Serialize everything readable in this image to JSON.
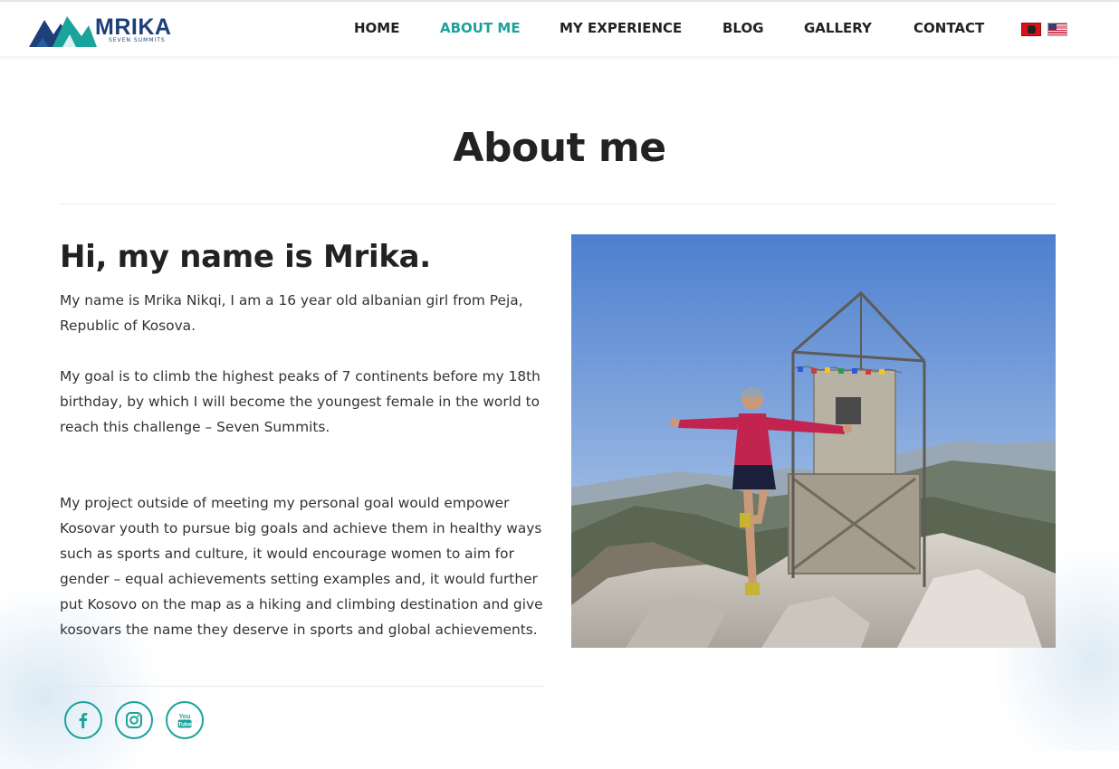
{
  "header": {
    "logo_text": "MRIKA",
    "logo_subtitle": "SEVEN SUMMITS",
    "nav": [
      {
        "label": "HOME"
      },
      {
        "label": "ABOUT ME"
      },
      {
        "label": "MY EXPERIENCE"
      },
      {
        "label": "BLOG"
      },
      {
        "label": "GALLERY"
      },
      {
        "label": "CONTACT"
      }
    ],
    "active_nav": "ABOUT ME",
    "languages": [
      "albanian-flag-icon",
      "us-flag-icon"
    ]
  },
  "page": {
    "title": "About me"
  },
  "about": {
    "greeting": "Hi, my name is Mrika.",
    "paragraphs": [
      "My name is Mrika Nikqi, I am a 16 year old albanian girl from Peja, Republic of Kosova.",
      "My goal is to climb the highest peaks of 7 continents before my 18th birthday, by which I will become the youngest female in the world to reach this challenge – Seven Summits.",
      "My project outside of meeting my personal goal would empower Kosovar youth to pursue big goals and achieve them in healthy ways such as sports and culture, it would encourage women to aim for gender – equal achievements setting examples and, it would further put Kosovo on the map as a hiking and climbing destination and give kosovars the name they deserve in sports and global achievements."
    ]
  },
  "social": [
    "facebook-icon",
    "instagram-icon",
    "youtube-icon"
  ],
  "colors": {
    "accent": "#1aa39a",
    "logo_blue": "#1d3f7a",
    "text": "#222222"
  }
}
